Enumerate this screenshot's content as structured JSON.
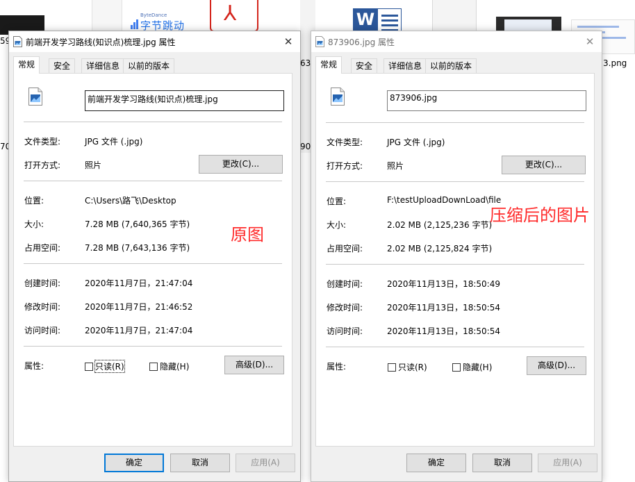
{
  "background": {
    "texts": [
      {
        "id": "bg-left-1",
        "text": "59"
      },
      {
        "id": "bg-left-2",
        "text": "70"
      },
      {
        "id": "bg-mid-1",
        "text": "63"
      },
      {
        "id": "bg-mid-2",
        "text": "90"
      },
      {
        "id": "bg-right-1",
        "text": "3.png"
      }
    ],
    "bytedance_small": "ByteDance",
    "bytedance_logo": "字节跳动",
    "word_letter": "W"
  },
  "dialog_left": {
    "title": "前端开发学习路线(知识点)梳理.jpg 属性",
    "close": "✕",
    "tabs": [
      "常规",
      "安全",
      "详细信息",
      "以前的版本"
    ],
    "filename": "前端开发学习路线(知识点)梳理.jpg",
    "labels": {
      "file_type": "文件类型:",
      "open_with": "打开方式:",
      "location": "位置:",
      "size": "大小:",
      "size_on_disk": "占用空间:",
      "created": "创建时间:",
      "modified": "修改时间:",
      "accessed": "访问时间:",
      "attributes": "属性:"
    },
    "values": {
      "file_type": "JPG 文件 (.jpg)",
      "open_with": "照片",
      "location": "C:\\Users\\路飞\\Desktop",
      "size": "7.28 MB (7,640,365 字节)",
      "size_on_disk": "7.28 MB (7,643,136 字节)",
      "created": "2020年11月7日，21:47:04",
      "modified": "2020年11月7日，21:46:52",
      "accessed": "2020年11月7日，21:47:04"
    },
    "change_button": "更改(C)...",
    "readonly": "只读(R)",
    "hidden": "隐藏(H)",
    "advanced_button": "高级(D)...",
    "ok": "确定",
    "cancel": "取消",
    "apply": "应用(A)"
  },
  "dialog_right": {
    "title": "873906.jpg 属性",
    "close": "✕",
    "tabs": [
      "常规",
      "安全",
      "详细信息",
      "以前的版本"
    ],
    "filename": "873906.jpg",
    "labels": {
      "file_type": "文件类型:",
      "open_with": "打开方式:",
      "location": "位置:",
      "size": "大小:",
      "size_on_disk": "占用空间:",
      "created": "创建时间:",
      "modified": "修改时间:",
      "accessed": "访问时间:",
      "attributes": "属性:"
    },
    "values": {
      "file_type": "JPG 文件 (.jpg)",
      "open_with": "照片",
      "location": "F:\\testUploadDownLoad\\file",
      "size": "2.02 MB (2,125,236 字节)",
      "size_on_disk": "2.02 MB (2,125,824 字节)",
      "created": "2020年11月13日，18:50:49",
      "modified": "2020年11月13日，18:50:54",
      "accessed": "2020年11月13日，18:50:54"
    },
    "change_button": "更改(C)...",
    "readonly": "只读(R)",
    "hidden": "隐藏(H)",
    "advanced_button": "高级(D)...",
    "ok": "确定",
    "cancel": "取消",
    "apply": "应用(A)"
  },
  "annotations": {
    "original": "原图",
    "compressed": "压缩后的图片"
  },
  "colors": {
    "annotation": "#ff2a2a",
    "primary_border": "#0078d7",
    "dialog_bg": "#f0f0f0"
  }
}
